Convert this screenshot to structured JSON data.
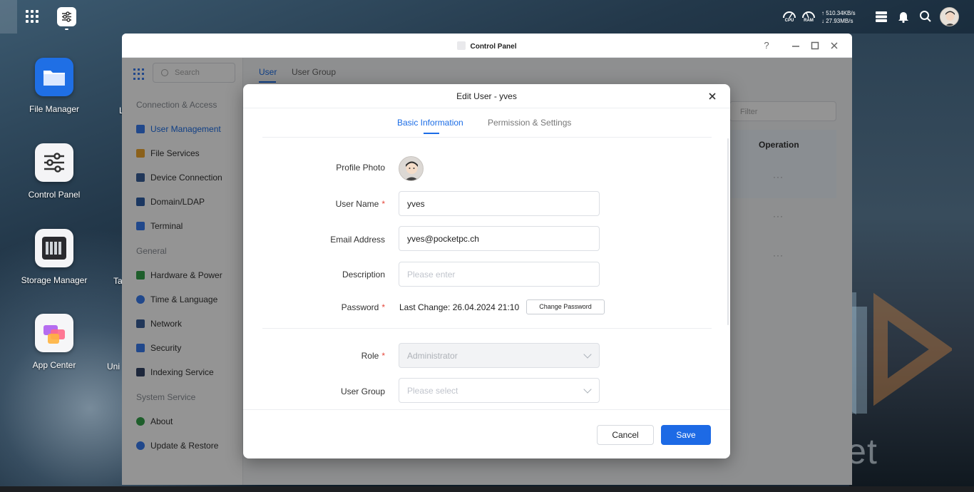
{
  "topbar": {
    "apps_icon": "grid-icon",
    "pinned_app_icon": "control-panel-icon",
    "cpu_label": "CPU",
    "ram_label": "RAM",
    "net_up": "↑ 510.34KB/s",
    "net_down": "↓ 27.93MB/s",
    "icons": [
      "storage-icon",
      "bell-icon",
      "search-icon",
      "avatar"
    ]
  },
  "desktop": {
    "icons": [
      {
        "label": "File Manager",
        "icon": "folder-icon"
      },
      {
        "label": "Control Panel",
        "icon": "sliders-icon"
      },
      {
        "label": "Storage Manager",
        "icon": "storage-icon"
      },
      {
        "label": "App Center",
        "icon": "app-center-icon"
      }
    ],
    "partial_labels": [
      "L",
      "Ta",
      "Uni"
    ]
  },
  "watermark": {
    "text": "Pocket"
  },
  "control_panel": {
    "title": "Control Panel",
    "help": "?",
    "search_placeholder": "Search",
    "sections": {
      "connection": "Connection & Access",
      "general": "General",
      "system": "System Service"
    },
    "items": {
      "user_management": "User Management",
      "file_services": "File Services",
      "device_connection": "Device Connection",
      "domain_ldap": "Domain/LDAP",
      "terminal": "Terminal",
      "hardware_power": "Hardware & Power",
      "time_language": "Time & Language",
      "network": "Network",
      "security": "Security",
      "indexing_service": "Indexing Service",
      "about": "About",
      "update_restore": "Update & Restore"
    },
    "tabs": {
      "user": "User",
      "user_group": "User Group"
    },
    "filter_placeholder": "Filter",
    "table": {
      "operation_header": "Operation",
      "row_action": "···"
    },
    "active_color": "#1c6de6"
  },
  "edit_user": {
    "title": "Edit User - yves",
    "tabs": {
      "basic": "Basic Information",
      "permission": "Permission & Settings"
    },
    "labels": {
      "profile_photo": "Profile Photo",
      "user_name": "User Name",
      "email": "Email Address",
      "description": "Description",
      "password": "Password",
      "role": "Role",
      "user_group": "User Group"
    },
    "required_mark": "*",
    "values": {
      "user_name": "yves",
      "email": "yves@pocketpc.ch",
      "description_placeholder": "Please enter",
      "password_last_change": "Last Change: 26.04.2024 21:10",
      "role": "Administrator",
      "user_group_placeholder": "Please select"
    },
    "buttons": {
      "change_password": "Change Password",
      "cancel": "Cancel",
      "save": "Save"
    },
    "primary_color": "#1d6ae5"
  }
}
